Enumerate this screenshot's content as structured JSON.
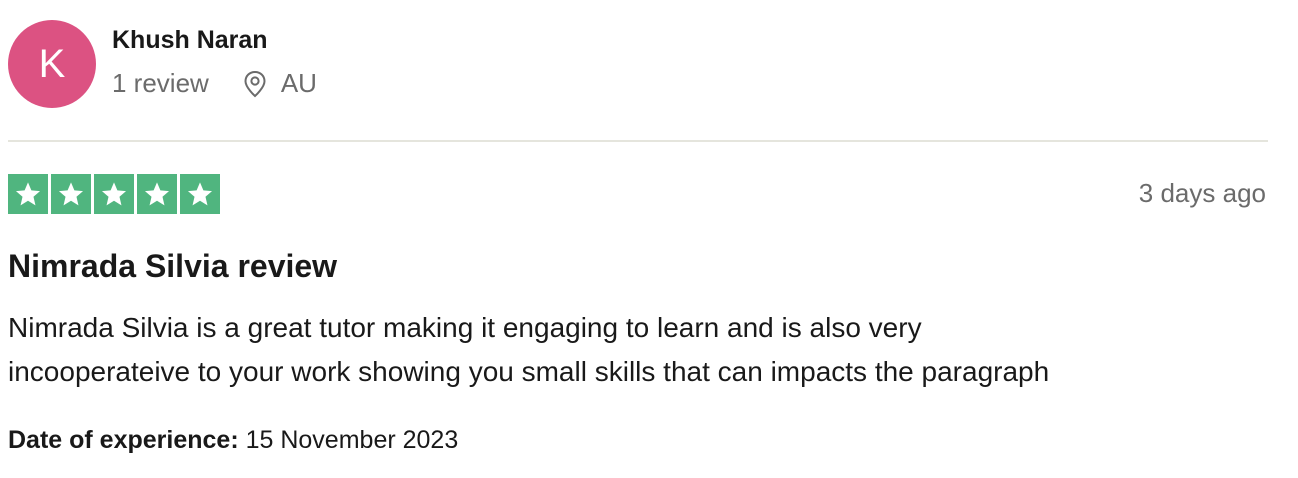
{
  "reviewer": {
    "avatar_initial": "K",
    "avatar_color": "#dc5282",
    "name": "Khush Naran",
    "review_count": "1 review",
    "location_icon": "map-pin-icon",
    "location": "AU"
  },
  "review": {
    "rating": 5,
    "rating_max": 5,
    "star_color": "#50b57f",
    "date_ago": "3 days ago",
    "title": "Nimrada Silvia review",
    "body_line1": "Nimrada Silvia is a great tutor making it engaging to learn and is also very",
    "body_line2": "incooperateive to your work showing you small skills that can impacts the paragraph",
    "experience_label": "Date of experience:",
    "experience_date": "15 November 2023"
  }
}
